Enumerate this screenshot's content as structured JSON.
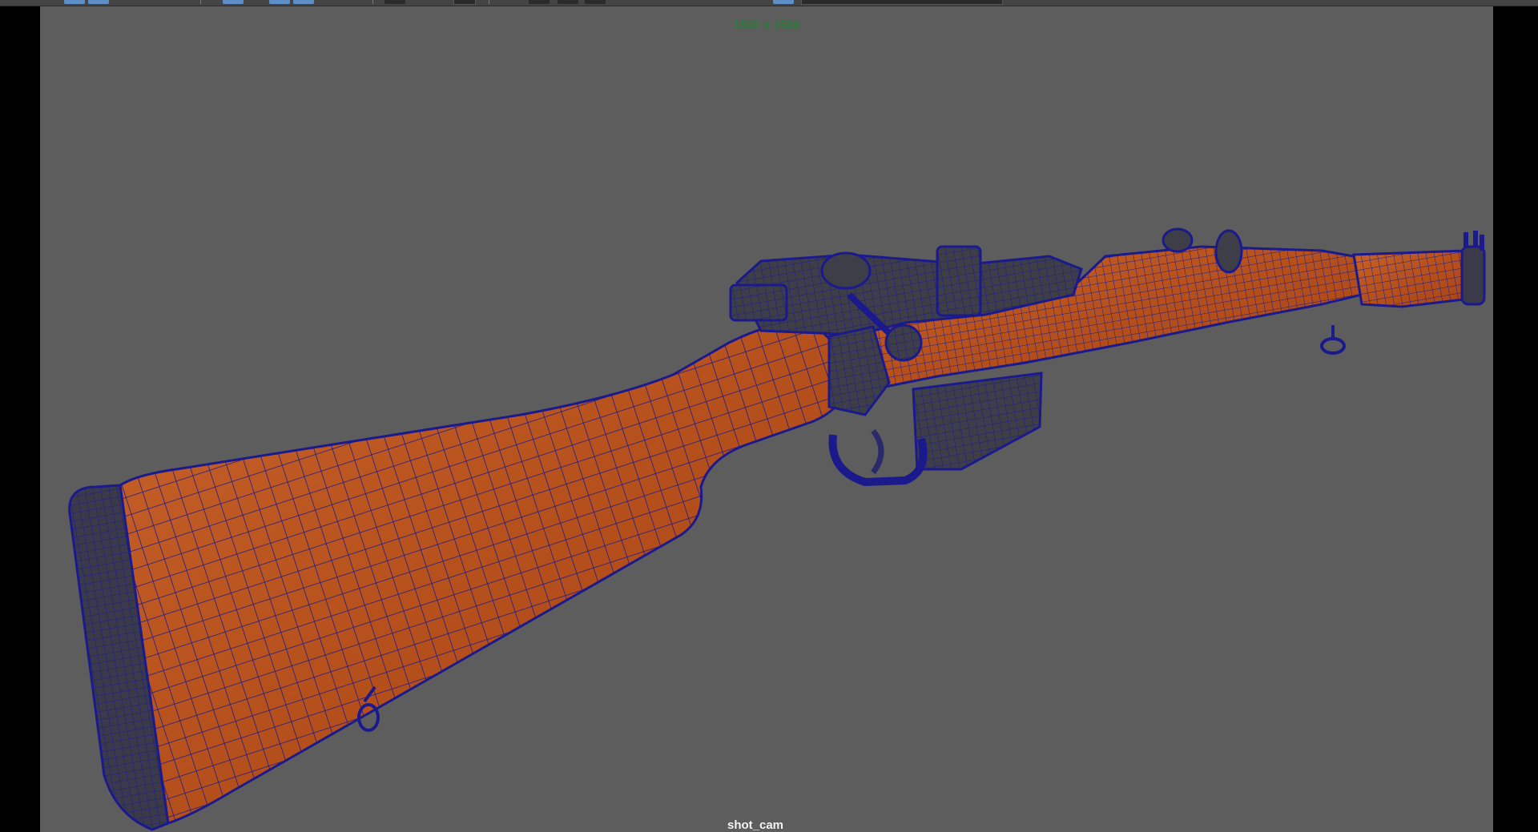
{
  "viewport": {
    "resolution_label": "1500 x 1500",
    "camera_name": "shot_cam",
    "background_color": "#5d5d5d",
    "wireframe_color": "#1a1a8c",
    "wood_color": "#b8531c",
    "metal_color": "#3a3a3a"
  },
  "toolbar": {
    "icons": [
      "select-icon",
      "move-icon",
      "camera-icon",
      "grid-icon",
      "wireframe-icon",
      "shaded-icon",
      "texture-icon",
      "light-icon",
      "resolution-gate-icon",
      "isolate-icon"
    ]
  }
}
